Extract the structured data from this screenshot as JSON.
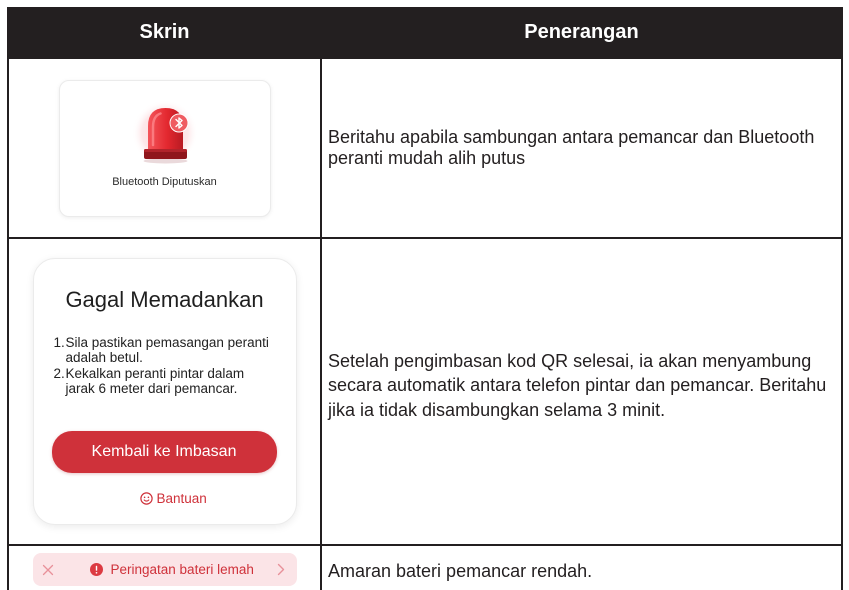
{
  "table": {
    "header": {
      "screen_column": "Skrin",
      "description_column": "Penerangan"
    },
    "rows": [
      {
        "screen": {
          "icon": "bluetooth-siren-icon",
          "label": "Bluetooth Diputuskan"
        },
        "description": "Beritahu apabila sambungan antara pemancar dan Bluetooth peranti mudah alih putus"
      },
      {
        "screen": {
          "title": "Gagal Memadankan",
          "steps": [
            {
              "number": "1.",
              "text": "Sila pastikan pemasangan peranti adalah betul."
            },
            {
              "number": "2.",
              "text": "Kekalkan peranti pintar dalam jarak 6 meter dari pemancar."
            }
          ],
          "button_label": "Kembali ke Imbasan",
          "help_icon": "smile-icon",
          "help_label": "Bantuan"
        },
        "description": "Setelah pengimbasan kod QR selesai, ia akan menyambung secara automatik antara telefon pintar dan pemancar. Beritahu jika ia tidak disambungkan selama 3 minit."
      },
      {
        "screen": {
          "close_icon": "close-icon",
          "warning_icon": "exclamation-circle-icon",
          "label": "Peringatan bateri lemah",
          "chevron_icon": "chevron-right-icon"
        },
        "description": "Amaran bateri pemancar rendah."
      }
    ]
  },
  "colors": {
    "table_border": "#231f20",
    "header_background": "#231f20",
    "header_text": "#ffffff",
    "body_text": "#231f20",
    "accent_red": "#cf313a",
    "banner_background": "#fbe4e7",
    "banner_muted_icon": "#e8919a",
    "card_border": "#ebebeb"
  }
}
